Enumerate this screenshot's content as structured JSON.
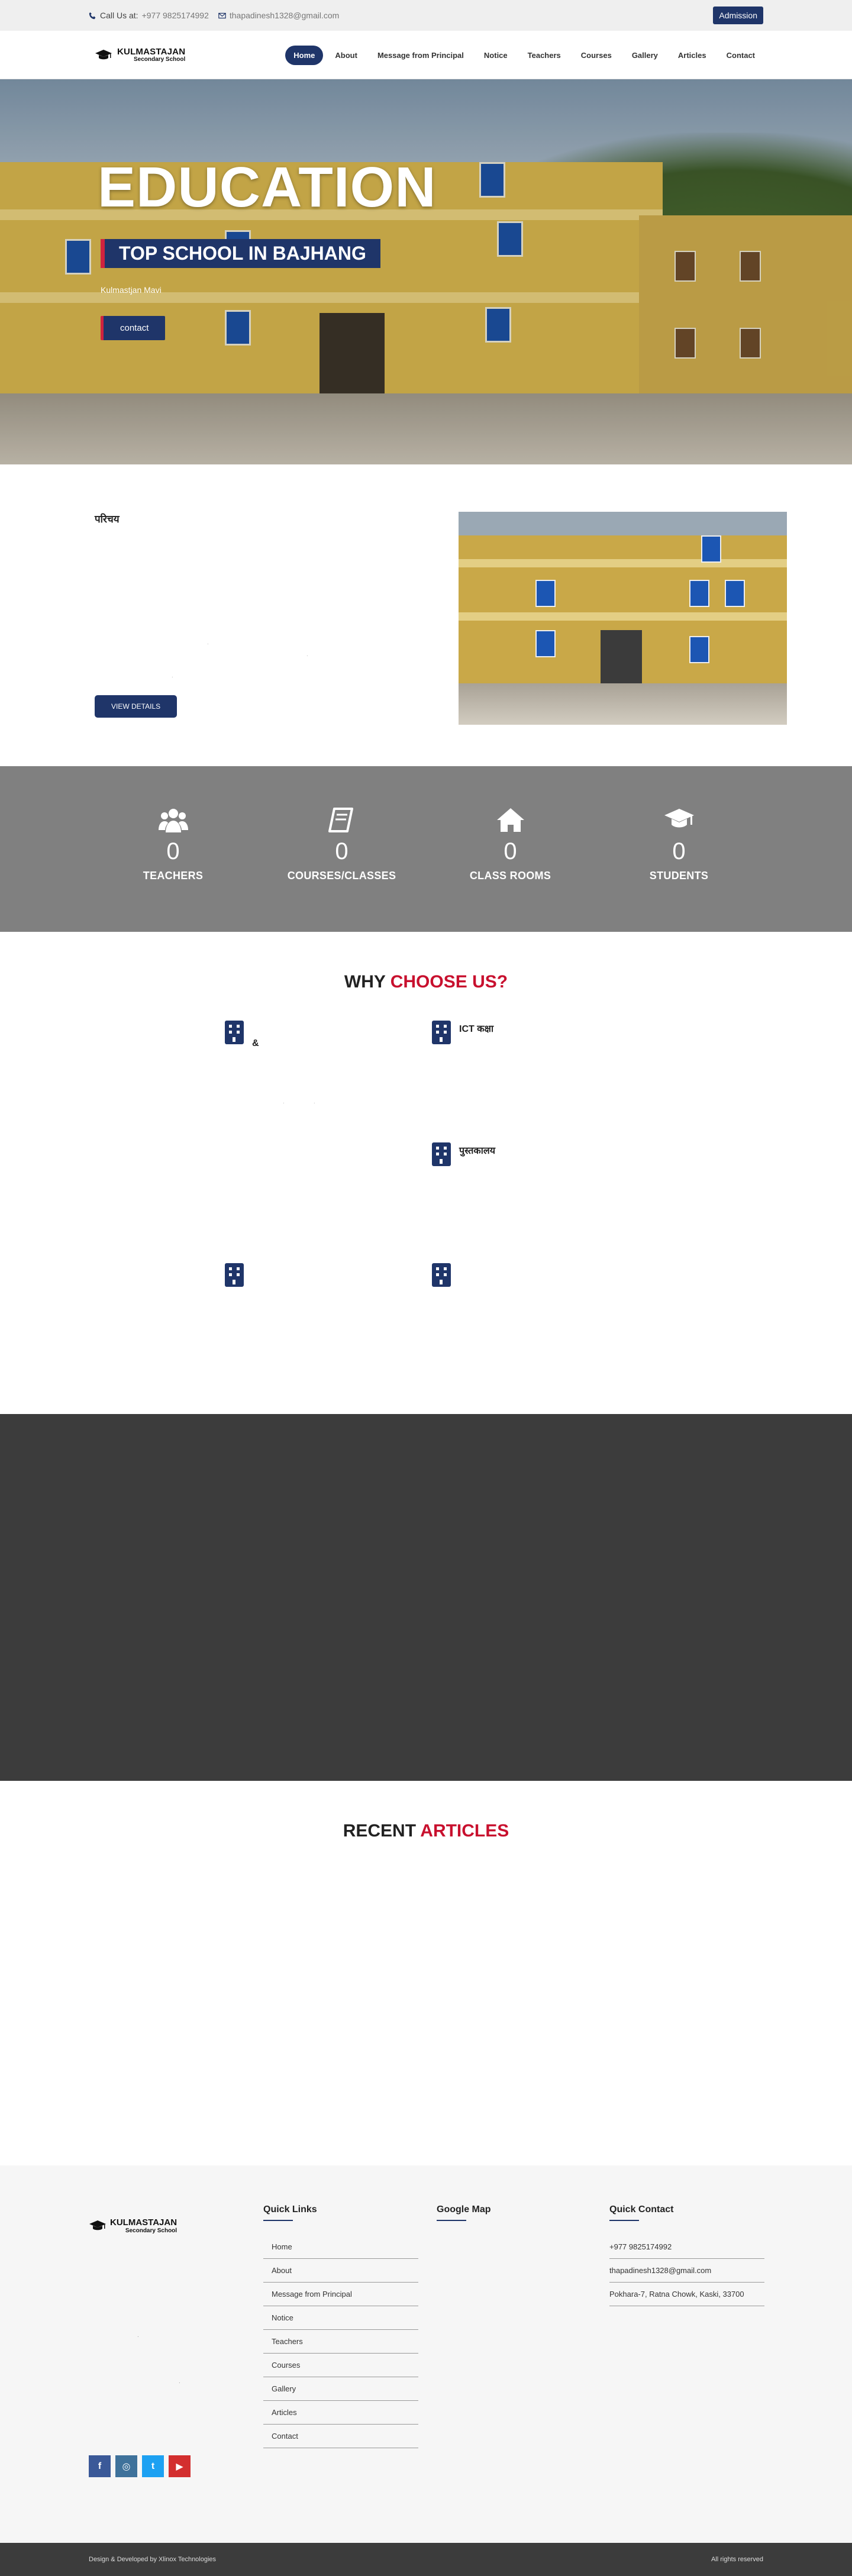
{
  "topbar": {
    "call_prefix": "Call Us at:",
    "phone": "+977 9825174992",
    "email": "thapadinesh1328@gmail.com",
    "admission_label": "Admission"
  },
  "brand": {
    "name": "KULMASTAJAN",
    "subtitle": "Secondary School"
  },
  "nav": {
    "items": [
      {
        "label": "Home",
        "active": true
      },
      {
        "label": "About"
      },
      {
        "label": "Message from Principal"
      },
      {
        "label": "Notice"
      },
      {
        "label": "Teachers"
      },
      {
        "label": "Courses"
      },
      {
        "label": "Gallery"
      },
      {
        "label": "Articles"
      },
      {
        "label": "Contact"
      }
    ]
  },
  "hero": {
    "title": "EDUCATION",
    "subtitle": "TOP SCHOOL IN BAJHANG",
    "location": "Kulmastjan Mavi",
    "button_label": "contact"
  },
  "about": {
    "heading": "परिचय",
    "button_label": "VIEW DETAILS"
  },
  "stats": [
    {
      "icon": "users-icon",
      "value": "0",
      "label": "TEACHERS"
    },
    {
      "icon": "book-icon",
      "value": "0",
      "label": "COURSES/CLASSES"
    },
    {
      "icon": "home-icon",
      "value": "0",
      "label": "CLASS ROOMS"
    },
    {
      "icon": "graduation-cap-icon",
      "value": "0",
      "label": "STUDENTS"
    }
  ],
  "why": {
    "title_main": "WHY",
    "title_accent": "CHOOSE US?",
    "features": [
      {
        "title": "&"
      },
      {
        "title": "ICT कक्षा"
      },
      {
        "title": "पुस्तकालय"
      },
      {
        "title": ""
      },
      {
        "title": ""
      }
    ]
  },
  "articles": {
    "title_main": "RECENT",
    "title_accent": "ARTICLES"
  },
  "footer": {
    "quick_links_title": "Quick Links",
    "quick_links": [
      "Home",
      "About",
      "Message from Principal",
      "Notice",
      "Teachers",
      "Courses",
      "Gallery",
      "Articles",
      "Contact"
    ],
    "map_title": "Google Map",
    "contact_title": "Quick Contact",
    "contact": [
      "+977 9825174992",
      "thapadinesh1328@gmail.com",
      "Pokhara-7, Ratna Chowk, Kaski, 33700"
    ],
    "socials": [
      {
        "icon": "facebook-icon",
        "glyph": "f",
        "color": "#3b5998"
      },
      {
        "icon": "instagram-icon",
        "glyph": "◎",
        "color": "#3f729b"
      },
      {
        "icon": "twitter-icon",
        "glyph": "t",
        "color": "#1da1f2"
      },
      {
        "icon": "youtube-icon",
        "glyph": "▶",
        "color": "#d32f2f"
      }
    ]
  },
  "bottom": {
    "credit": "Design & Developed by Xlinox Technologies",
    "rights": "All rights reserved"
  }
}
